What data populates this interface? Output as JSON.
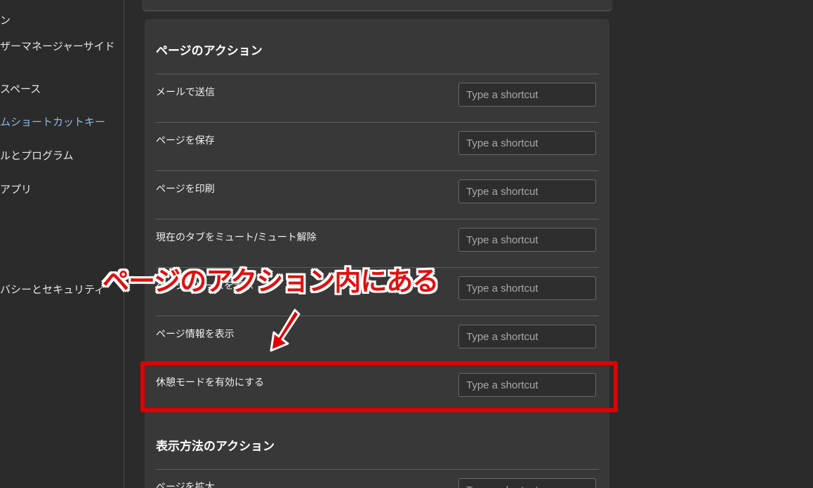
{
  "sidebar": {
    "items": [
      {
        "label": "ン",
        "active": false
      },
      {
        "label": "ザーマネージャーサイド",
        "active": false
      },
      {
        "label": "スペース",
        "active": false
      },
      {
        "label": "ムショートカットキー",
        "active": true
      },
      {
        "label": "ルとプログラム",
        "active": false
      },
      {
        "label": "アプリ",
        "active": false
      },
      {
        "label": "バシーとセキュリティ",
        "active": false
      }
    ]
  },
  "page_actions": {
    "title": "ページのアクション",
    "rows": [
      {
        "label": "メールで送信"
      },
      {
        "label": "ページを保存"
      },
      {
        "label": "ページを印刷"
      },
      {
        "label": "現在のタブをミュート/ミュート解除"
      },
      {
        "label": "ページのソースを表示"
      },
      {
        "label": "ページ情報を表示"
      },
      {
        "label": "休憩モードを有効にする"
      }
    ]
  },
  "view_actions": {
    "title": "表示方法のアクション",
    "rows": [
      {
        "label": "ページを拡大"
      }
    ]
  },
  "shortcut_placeholder": "Type a shortcut",
  "annotation": {
    "callout_text": "ページのアクション内にある",
    "color": "#e00000"
  },
  "colors": {
    "background": "#2b2b2b",
    "card": "#383838",
    "active_nav": "#8fb9e6"
  }
}
